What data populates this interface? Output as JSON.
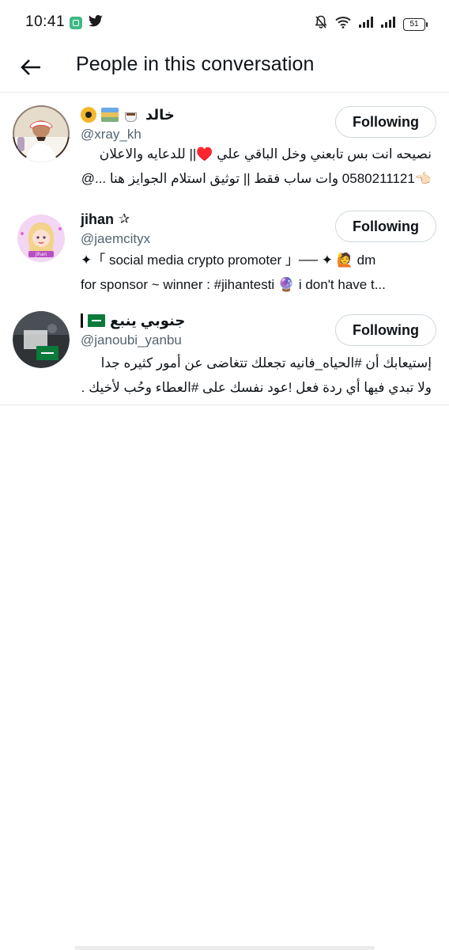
{
  "status_bar": {
    "time": "10:41",
    "battery": "51",
    "icons": [
      "app-notification-icon",
      "twitter-bird-icon",
      "mute-bell-icon",
      "wifi-icon",
      "signal-icon",
      "signal-icon",
      "battery-icon"
    ]
  },
  "header": {
    "title": "People in this conversation",
    "back_icon": "arrow-left-icon"
  },
  "people": [
    {
      "name": "خالد",
      "name_emojis": [
        "radioactive-emoji",
        "books-emoji",
        "coffee-emoji"
      ],
      "handle": "@xray_kh",
      "bio_lines": [
        "نصيحه انت بس تابعني وخل الباقي علي ♥️|| للدعايه والاعلان",
        "👈🏻0580211121 وات ساب فقط || توثيق استلام الجوايز هنا ...@"
      ],
      "follow_label": "Following"
    },
    {
      "name": "jihan",
      "name_suffix": "✰",
      "handle": "@jaemcityx",
      "bio_lines": [
        "✦「 social media crypto promoter 」── ✦ 🙋 dm",
        "for sponsor ~ winner : #jihantesti 🔮 i don't have t..."
      ],
      "follow_label": "Following"
    },
    {
      "name": "جنوبي ينبع",
      "name_emojis": [
        "saudi-flag-emoji",
        "pipe-mark"
      ],
      "handle": "@janoubi_yanbu",
      "bio_lines": [
        "إستيعابك أن #الحياه_فانيه تجعلك تتغاضى عن أمور كثيره جدا",
        "ولا تبدي فيها أي ردة فعل !عود نفسك على #العطاء وحُب لأخيك ..."
      ],
      "follow_label": "Following"
    }
  ]
}
